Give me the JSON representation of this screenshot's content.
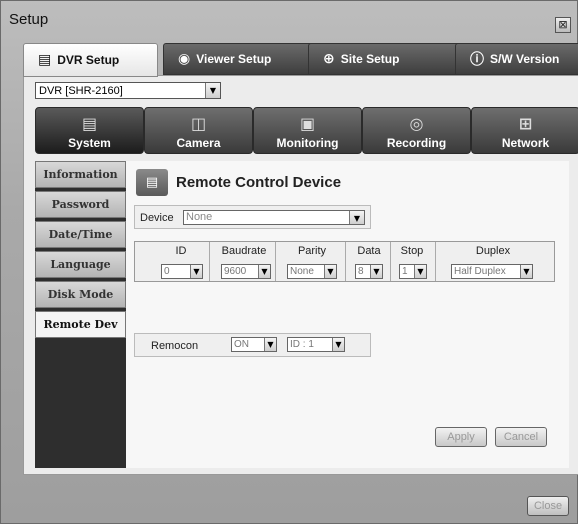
{
  "window": {
    "title": "Setup",
    "close_glyph": "⊠"
  },
  "tabs": [
    {
      "label": "DVR Setup",
      "icon": "dvr-wrench-icon",
      "glyph": "▤"
    },
    {
      "label": "Viewer Setup",
      "icon": "eye-wrench-icon",
      "glyph": "◉"
    },
    {
      "label": "Site Setup",
      "icon": "globe-wrench-icon",
      "glyph": "⊕"
    },
    {
      "label": "S/W Version",
      "icon": "info-icon",
      "glyph": "ⓘ"
    }
  ],
  "dvr_select": {
    "value": "DVR [SHR-2160]"
  },
  "categories": [
    {
      "label": "System",
      "glyph": "▤"
    },
    {
      "label": "Camera",
      "glyph": "◫"
    },
    {
      "label": "Monitoring",
      "glyph": "▣"
    },
    {
      "label": "Recording",
      "glyph": "◎"
    },
    {
      "label": "Network",
      "glyph": "⊞"
    }
  ],
  "sidebar": [
    "Information",
    "Password",
    "Date/Time",
    "Language",
    "Disk Mode",
    "Remote Dev"
  ],
  "content": {
    "title": "Remote Control Device",
    "device_label": "Device",
    "device_value": "None",
    "columns": [
      "ID",
      "Baudrate",
      "Parity",
      "Data",
      "Stop",
      "Duplex"
    ],
    "row": [
      "0",
      "9600",
      "None",
      "8",
      "1",
      "Half Duplex"
    ],
    "remocon_label": "Remocon",
    "remocon_value": "ON",
    "remocon_id": "ID : 1",
    "apply": "Apply",
    "cancel": "Cancel"
  },
  "footer": {
    "close": "Close"
  },
  "dd_glyph": "▼"
}
